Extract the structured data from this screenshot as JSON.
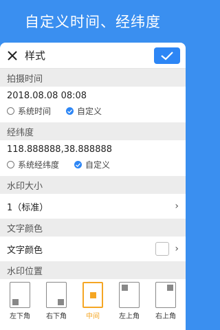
{
  "banner": {
    "title": "自定义时间、经纬度"
  },
  "toolbar": {
    "title": "样式"
  },
  "sections": {
    "time": {
      "header": "拍摄时间",
      "value": "2018.08.08 08:08",
      "options": [
        "系统时间",
        "自定义"
      ],
      "selected": "自定义"
    },
    "coords": {
      "header": "经纬度",
      "value": "118.888888,38.888888",
      "options": [
        "系统经纬度",
        "自定义"
      ],
      "selected": "自定义"
    },
    "size": {
      "header": "水印大小",
      "value": "1（标准）"
    },
    "color": {
      "header": "文字颜色",
      "label": "文字颜色",
      "swatch": "#ffffff"
    },
    "position": {
      "header": "水印位置",
      "items": [
        "左下角",
        "右下角",
        "中间",
        "左上角",
        "右上角"
      ],
      "selected": "中间"
    }
  },
  "colors": {
    "accent": "#2d86f5",
    "background": "#3a8ff0",
    "selected": "#f5a623"
  },
  "icons": {
    "close": "close-icon",
    "confirm": "check-icon",
    "chevron": "chevron-right-icon"
  }
}
